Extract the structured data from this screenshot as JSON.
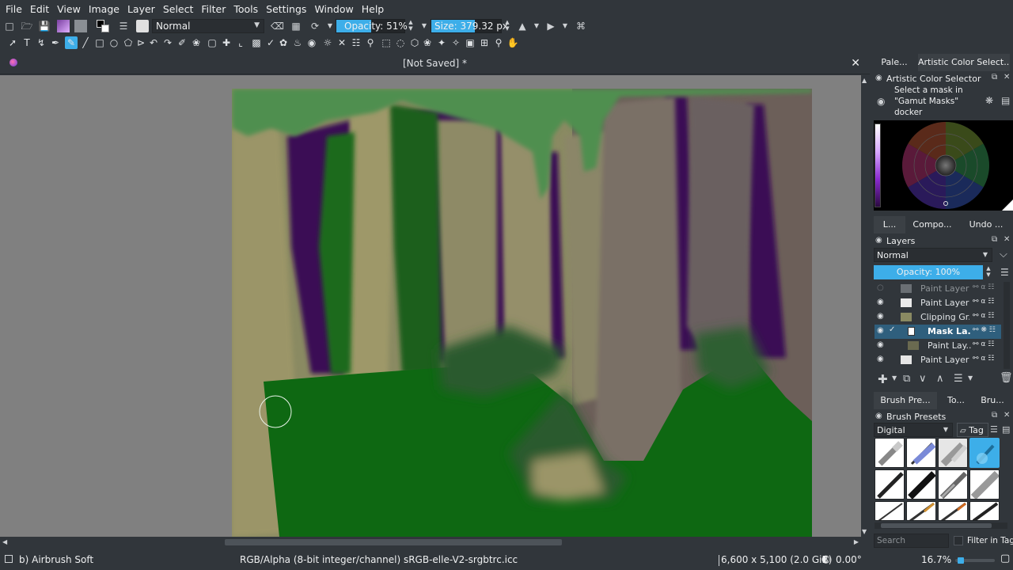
{
  "menu": [
    "File",
    "Edit",
    "View",
    "Image",
    "Layer",
    "Select",
    "Filter",
    "Tools",
    "Settings",
    "Window",
    "Help"
  ],
  "toolbar": {
    "blend_mode": "Normal",
    "opacity_text": "Opacity: 51%",
    "opacity_value": 0.51,
    "size_text": "Size: 379.32 px",
    "size_value": 379.32
  },
  "document": {
    "title": "[Not Saved]  *"
  },
  "dock": {
    "top_tabs": [
      "Pale...",
      "Artistic Color Select..."
    ],
    "color_selector": {
      "title": "Artistic Color Selector",
      "hint": "Select a mask in \"Gamut Masks\" docker"
    },
    "mid_tabs": [
      "L...",
      "Compo...",
      "Undo ..."
    ],
    "layers": {
      "title": "Layers",
      "blend_mode": "Normal",
      "opacity_text": "Opacity:  100%",
      "items": [
        {
          "name": "Paint Layer ...",
          "visible": false,
          "selected": false,
          "indent": 0
        },
        {
          "name": "Paint Layer ...",
          "visible": true,
          "selected": false,
          "indent": 0
        },
        {
          "name": "Clipping Gr...",
          "visible": true,
          "selected": false,
          "indent": 0
        },
        {
          "name": "Mask La...",
          "visible": true,
          "selected": true,
          "indent": 1
        },
        {
          "name": "Paint Lay...",
          "visible": true,
          "selected": false,
          "indent": 1
        },
        {
          "name": "Paint Layer ...",
          "visible": true,
          "selected": false,
          "indent": 0
        }
      ]
    },
    "bottom_tabs": [
      "Brush Pre...",
      "To...",
      "Bru..."
    ],
    "brush_presets": {
      "title": "Brush Presets",
      "tag_filter": "Digital",
      "tag_button": "Tag",
      "search_placeholder": "Search",
      "filter_in_tag": "Filter in Tag"
    }
  },
  "status": {
    "brush": "b) Airbrush Soft",
    "color_space": "RGB/Alpha (8-bit integer/channel)  sRGB-elle-V2-srgbtrc.icc",
    "dimensions": "6,600 x 5,100 (2.0 GiB)",
    "rotation": "0.00°",
    "zoom": "16.7%",
    "zoom_fraction": 0.167
  },
  "colors": {
    "accent": "#3daee9",
    "background": "#31363b",
    "canvas_bg": "#808080",
    "sky_green": "#4f8f4f",
    "tree_khaki": "#9b9568",
    "ground_green": "#0e6812",
    "shadow_purple": "#3a0a55"
  }
}
